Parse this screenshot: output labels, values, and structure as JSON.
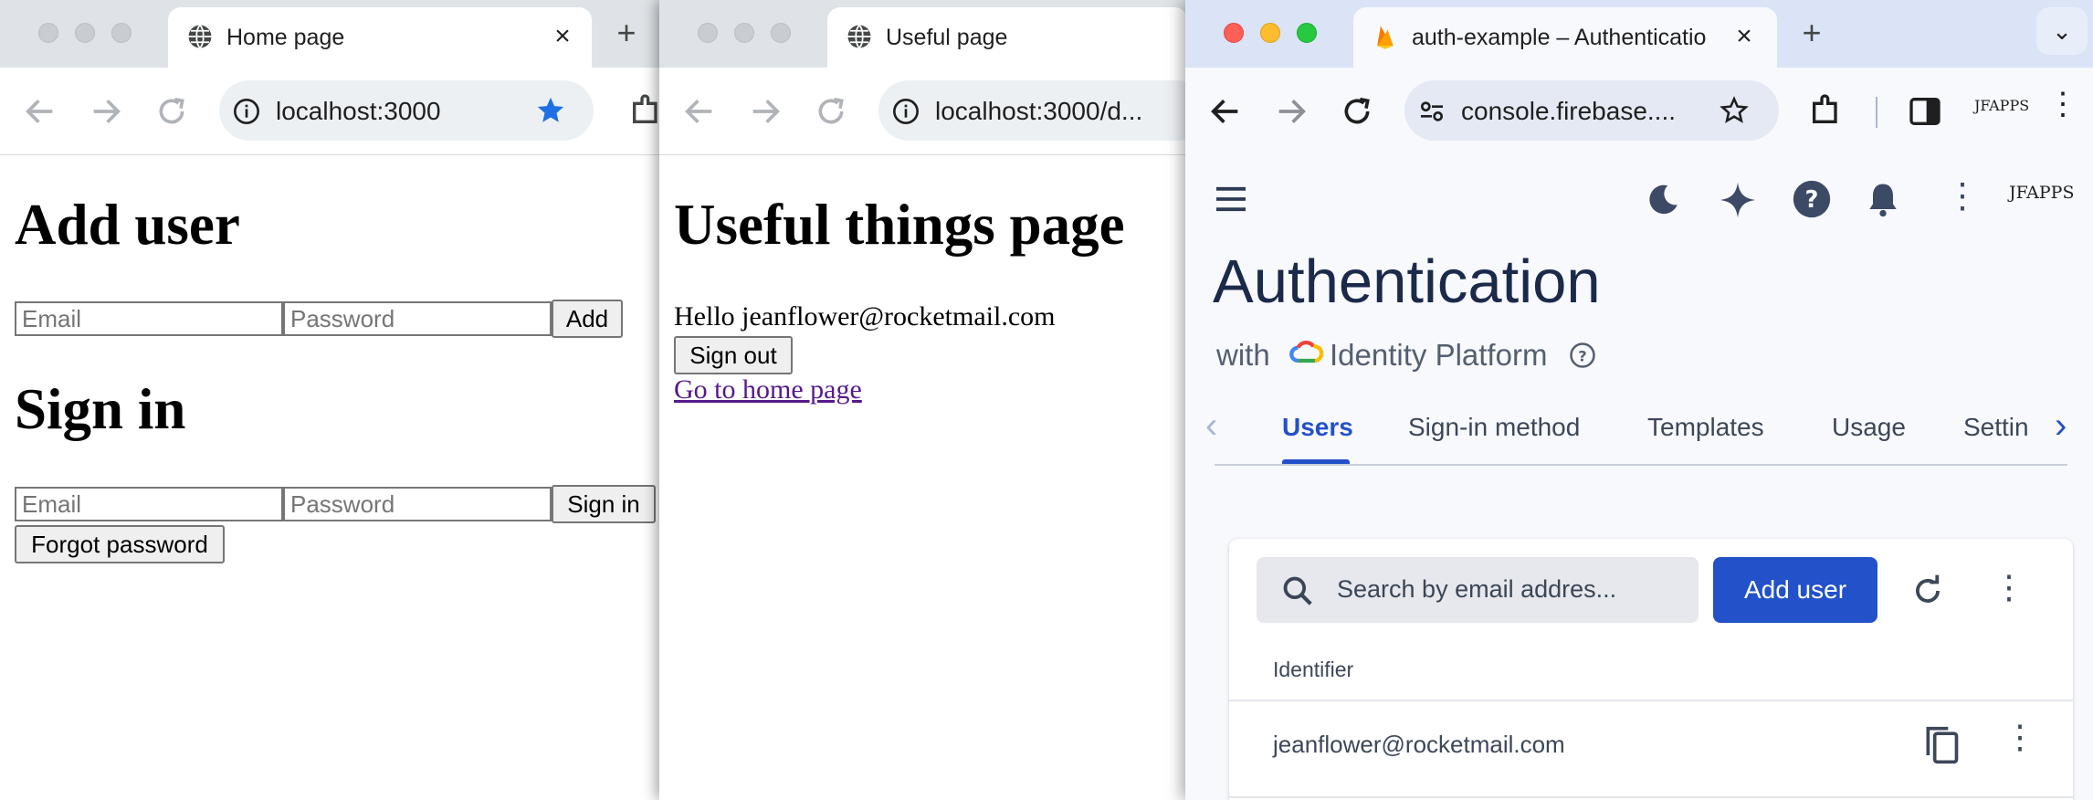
{
  "window1": {
    "tab_title": "Home page",
    "url": "localhost:3000",
    "page": {
      "add_user_heading": "Add user",
      "add_email_placeholder": "Email",
      "add_password_placeholder": "Password",
      "add_button": "Add",
      "sign_in_heading": "Sign in",
      "signin_email_placeholder": "Email",
      "signin_password_placeholder": "Password",
      "sign_in_button": "Sign in",
      "forgot_password_button": "Forgot password"
    }
  },
  "window2": {
    "tab_title": "Useful page",
    "url": "localhost:3000/d...",
    "page": {
      "heading": "Useful things page",
      "greeting": "Hello jeanflower@rocketmail.com",
      "sign_out_button": "Sign out",
      "home_link": "Go to home page"
    }
  },
  "window3": {
    "tab_title": "auth-example – Authenticatio",
    "url": "console.firebase....",
    "profile_label": "JFAPPS",
    "console": {
      "title": "Authentication",
      "with_label": "with",
      "platform_label": "Identity Platform",
      "tabs": [
        "Users",
        "Sign-in method",
        "Templates",
        "Usage",
        "Settin"
      ],
      "active_tab": "Users",
      "search_placeholder": "Search by email addres...",
      "add_user_button": "Add user",
      "column_identifier": "Identifier",
      "rows": [
        {
          "identifier": "jeanflower@rocketmail.com"
        }
      ]
    }
  },
  "colors": {
    "accent_blue": "#2251c9",
    "bookmark_star": "#1f6fe5",
    "link_visited": "#551a8b"
  }
}
